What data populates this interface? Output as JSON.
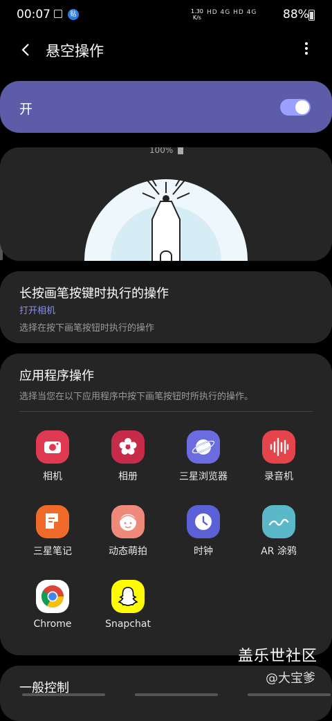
{
  "status_bar": {
    "time": "00:07",
    "badge": "贴",
    "net_speed": "1.30\nK/s",
    "icons_text": "HD 4G HD 4G",
    "battery": "88%"
  },
  "app_bar": {
    "title": "悬空操作"
  },
  "master_switch": {
    "label": "开",
    "on": true
  },
  "illustration": {
    "battery_text": "100%"
  },
  "long_press": {
    "title": "长按画笔按键时执行的操作",
    "value": "打开相机",
    "desc": "选择在按下画笔按钮时执行的操作"
  },
  "app_actions": {
    "title": "应用程序操作",
    "desc": "选择当您在以下应用程序中按下画笔按钮时所执行的操作。",
    "apps": [
      {
        "name": "相机",
        "icon": "camera-icon",
        "color": "#e03a52"
      },
      {
        "name": "相册",
        "icon": "gallery-icon",
        "color": "#c72b4a"
      },
      {
        "name": "三星浏览器",
        "icon": "browser-icon",
        "color": "#6a6ce0"
      },
      {
        "name": "录音机",
        "icon": "recorder-icon",
        "color": "#e4444a"
      },
      {
        "name": "三星笔记",
        "icon": "notes-icon",
        "color": "#f06a2a"
      },
      {
        "name": "动态萌拍",
        "icon": "ar-emoji-icon",
        "color": "#ef8a7a"
      },
      {
        "name": "时钟",
        "icon": "clock-icon",
        "color": "#5b60d6"
      },
      {
        "name": "AR 涂鸦",
        "icon": "ar-doodle-icon",
        "color": "#5ab8c8"
      },
      {
        "name": "Chrome",
        "icon": "chrome-icon",
        "color": "#ffffff"
      },
      {
        "name": "Snapchat",
        "icon": "snapchat-icon",
        "color": "#fffc00"
      }
    ]
  },
  "general": {
    "title": "一般控制"
  },
  "watermark": {
    "line1": "盖乐世社区",
    "line2": "@大宝爹"
  }
}
